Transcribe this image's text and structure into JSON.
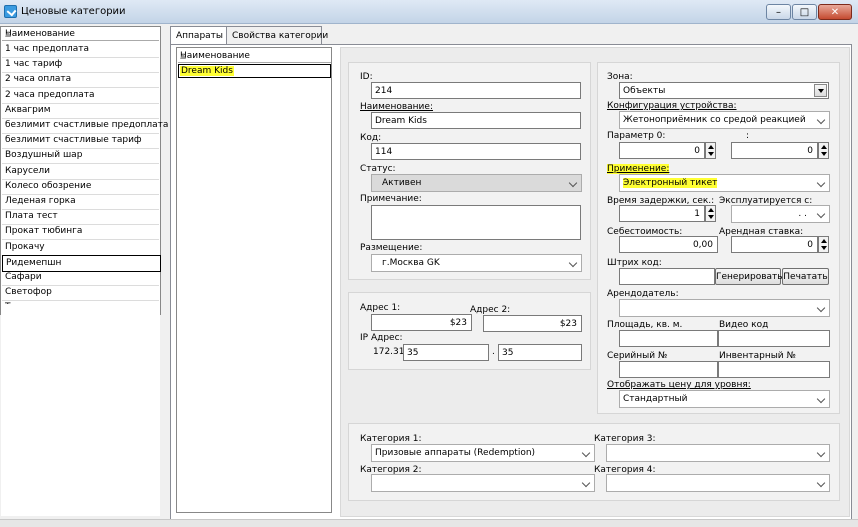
{
  "window": {
    "title": "Ценовые категории",
    "minimize": "–",
    "maximize": "□",
    "close": "✕"
  },
  "left_list": {
    "header": "Наименование",
    "sort_icon": "▲",
    "items": [
      "1 час предоплата",
      "1 час тариф",
      "2 часа оплата",
      "2 часа предоплата",
      "Аквагрим",
      "безлимит счастливые предоплата",
      "безлимит счастливые тариф",
      "Воздушный шар",
      "Карусели",
      "Колесо обозрение",
      "Леденая горка",
      "Плата тест",
      "Прокат тюбинга",
      "Прокачу",
      "Ридемепшн",
      "Сафари",
      "Светофор",
      "Турникет"
    ],
    "selected_index": 14
  },
  "tabs": [
    {
      "label": "Аппараты",
      "active": true
    },
    {
      "label": "Свойства категории",
      "active": false
    }
  ],
  "grid": {
    "header": "Наименование",
    "sort_icon": "▲",
    "rows": [
      "Dream Kids"
    ]
  },
  "form": {
    "id_label": "ID:",
    "id_value": "214",
    "name_label": "Наименование:",
    "name_value": "Dream Kids",
    "code_label": "Код:",
    "code_value": "114",
    "status_label": "Статус:",
    "status_value": "Активен",
    "note_label": "Примечание:",
    "note_value": "",
    "placement_label": "Размещение:",
    "placement_value": "г.Москва GK",
    "addr1_label": "Адрес 1:",
    "addr1_value": "$23",
    "addr2_label": "Адрес 2:",
    "addr2_value": "$23",
    "ip_label": "IP Адрес:",
    "ip_prefix": "172.31",
    "ip_part3": "35",
    "ip_dot": ".",
    "ip_part4": "35",
    "zone_label": "Зона:",
    "zone_value": "Объекты",
    "config_label": "Конфигурация устройства:",
    "config_value": "Жетоноприёмник со средой реакцией",
    "param0_label": "Параметр 0:",
    "param0_value": "0",
    "param_colon": ":",
    "param1_value": "0",
    "usage_label": "Применение:",
    "usage_value": "Электронный тикет",
    "delay_label": "Время задержки, сек.:",
    "delay_value": "1",
    "operated_label": "Эксплуатируется с:",
    "operated_value": ". .",
    "cost_label": "Себестоимость:",
    "cost_value": "0,00",
    "rent_label": "Арендная ставка:",
    "rent_value": "0",
    "barcode_label": "Штрих код:",
    "barcode_value": "",
    "generate_button": "Генерировать",
    "print_button": "Печатать",
    "lessor_label": "Арендодатель:",
    "lessor_value": "",
    "area_label": "Площадь, кв. м.",
    "area_value": "",
    "video_label": "Видео код",
    "video_value": "",
    "serial_label": "Серийный №",
    "serial_value": "",
    "inventory_label": "Инвентарный №",
    "inventory_value": "",
    "price_level_label": "Отображать цену для уровня:",
    "price_level_value": "Стандартный",
    "cat1_label": "Категория 1:",
    "cat1_value": "Призовые аппараты (Redemption)",
    "cat2_label": "Категория 2:",
    "cat2_value": "",
    "cat3_label": "Категория 3:",
    "cat3_value": "",
    "cat4_label": "Категория 4:",
    "cat4_value": ""
  }
}
